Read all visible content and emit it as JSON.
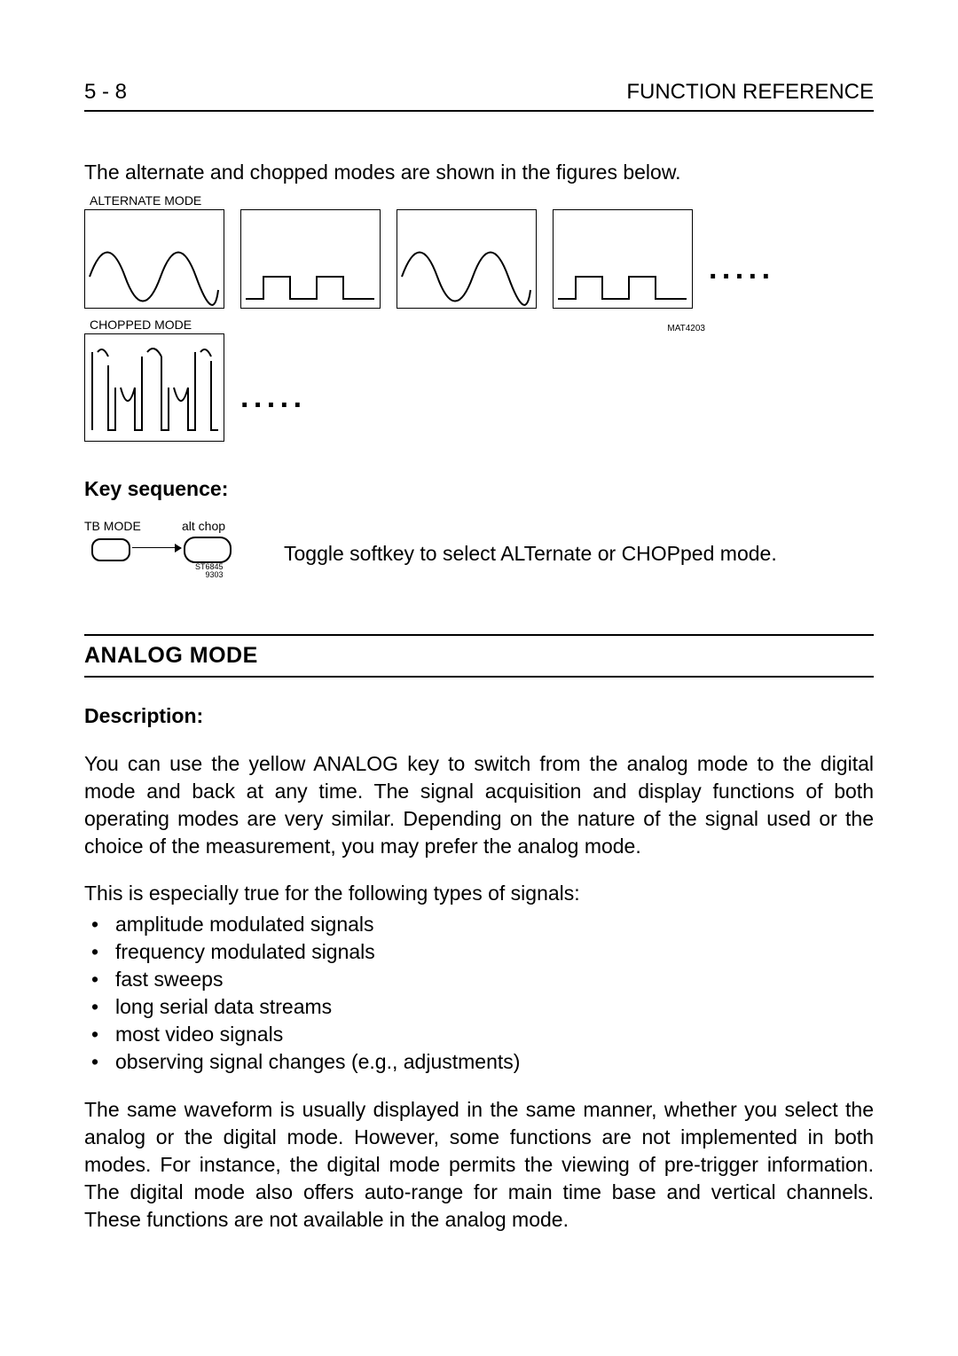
{
  "header": {
    "pageNum": "5 - 8",
    "title": "FUNCTION REFERENCE"
  },
  "intro": "The alternate and chopped modes are shown in the figures below.",
  "figures": {
    "altLabel": "ALTERNATE MODE",
    "chopLabel": "CHOPPED MODE",
    "code": "MAT4203",
    "ellipsis": ". . . . .",
    "ellipsis2": ". . . . ."
  },
  "keySeq": {
    "title": "Key sequence:",
    "btn1Label": "TB MODE",
    "btn2Label": "alt  chop",
    "codeLine1": "ST6845",
    "codeLine2": "9303",
    "text": "Toggle softkey to select ALTernate or CHOPped mode."
  },
  "section": {
    "title": "ANALOG MODE",
    "descTitle": "Description:",
    "para1": "You can use the yellow ANALOG key to switch from the analog mode to the digital mode and back at any time. The signal acquisition and display functions of both operating modes are very similar. Depending on the nature of the signal used or the choice of the measurement, you may prefer the analog mode.",
    "para2": "This is especially true for the following types of signals:",
    "bullets": [
      "amplitude modulated signals",
      "frequency modulated signals",
      "fast sweeps",
      "long serial data streams",
      "most video signals",
      "observing signal changes (e.g., adjustments)"
    ],
    "para3": "The same waveform is usually displayed in the same manner, whether you select the analog or the digital mode. However, some functions are not implemented in both modes. For instance, the digital mode permits the viewing of pre-trigger information. The digital mode also offers auto-range for main time base and vertical channels. These functions are not available in the analog mode."
  }
}
